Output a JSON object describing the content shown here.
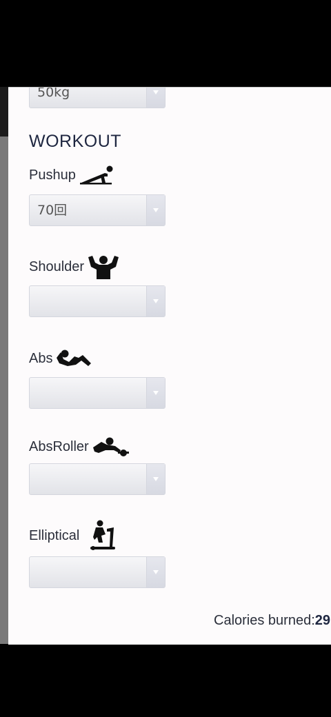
{
  "weight": {
    "value": "50kg"
  },
  "workout": {
    "title": "WORKOUT",
    "items": [
      {
        "label": "Pushup",
        "value": "70回",
        "icon": "pushup-icon"
      },
      {
        "label": "Shoulder",
        "value": "",
        "icon": "shoulder-icon"
      },
      {
        "label": "Abs",
        "value": "",
        "icon": "abs-icon"
      },
      {
        "label": "AbsRoller",
        "value": "",
        "icon": "abs-roller-icon"
      },
      {
        "label": "Elliptical",
        "value": "",
        "icon": "elliptical-icon"
      }
    ]
  },
  "calories": {
    "label": "Calories burned:",
    "value": "29"
  }
}
